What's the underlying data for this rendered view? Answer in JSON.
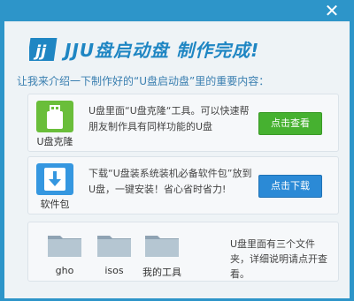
{
  "window": {
    "close_glyph": "✕"
  },
  "header": {
    "logo_icon": "jj-logo-icon",
    "title": "JJU盘启动盘 制作完成!",
    "intro": "让我来介绍一下制作好的“U盘启动盘”里的重要内容："
  },
  "sections": [
    {
      "icon": "usb-clone-icon",
      "icon_label": "U盘克隆",
      "description": "U盘里面“U盘克隆“工具。可以快速帮朋友制作具有同样功能的U盘",
      "button": "点击查看",
      "accent": "#46b130"
    },
    {
      "icon": "download-package-icon",
      "icon_label": "软件包",
      "description": "下载“U盘装系统装机必备软件包”放到U盘，一键安装！省心省时省力!",
      "button": "点击下载",
      "accent": "#2b8ad6"
    }
  ],
  "folders": [
    {
      "name": "gho",
      "icon": "folder-icon"
    },
    {
      "name": "isos",
      "icon": "folder-icon"
    },
    {
      "name": "我的工具",
      "icon": "folder-icon"
    }
  ],
  "folders_description": "U盘里面有三个文件夹，详细说明请点开查看。"
}
